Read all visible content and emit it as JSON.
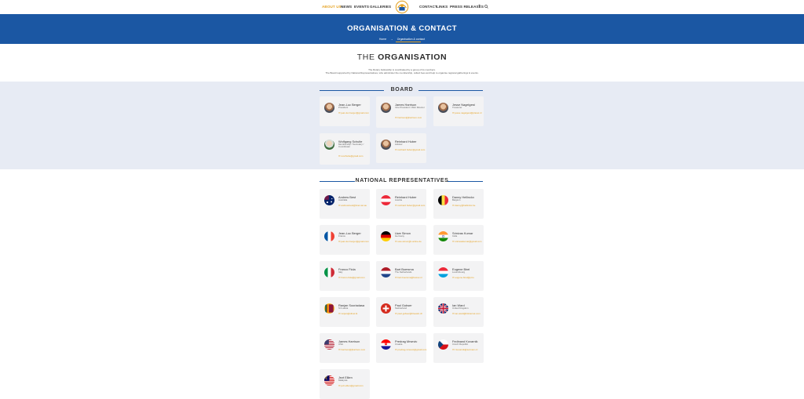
{
  "nav": {
    "left": [
      "ABOUT US",
      "NEWS",
      "EVENTS",
      "GALLERIES"
    ],
    "right": [
      "CONTACT",
      "LINKS",
      "PRESS RELEASES"
    ],
    "active": "ABOUT US",
    "icons": [
      "menu-plus-icon",
      "search-icon"
    ]
  },
  "hero": {
    "title": "ORGANISATION & CONTACT",
    "breadcrumb": [
      "Home",
      "→",
      "Organisation & contact"
    ]
  },
  "org": {
    "title_prefix": "THE",
    "title_bold": "ORGANISATION",
    "intro": [
      "The Rotary Fellowship is coordinated by a group of its members.",
      "The Board supported by National Representatives, who administer the membership, collect fees and help to organise regional gatherings & events."
    ]
  },
  "board": {
    "heading": "BOARD",
    "members": [
      {
        "name": "Jean-Luc Berger",
        "role": "President",
        "email": "jean-luc.berger@gmail.com",
        "avatar": "photo"
      },
      {
        "name": "James Harrison",
        "role": "Vice President / Web Director",
        "email": "harrison@jharrison.com",
        "avatar": "photo"
      },
      {
        "name": "Jesse Nagelgest",
        "role": "Treasurer",
        "email": "jesse.nagelgest@planet.nl",
        "avatar": "photo"
      },
      {
        "name": "Wolfgang Schulte",
        "role": "Membership / Secretary / Coordinator",
        "email": "w.schulte@gmail.com",
        "avatar": "green"
      },
      {
        "name": "Reinhard Huber",
        "role": "Advisor",
        "email": "reinhard.huber@gmail.com",
        "avatar": "photo"
      }
    ]
  },
  "reps": {
    "heading": "NATIONAL REPRESENTATIVES",
    "members": [
      {
        "name": "Andrew Best",
        "country": "Australia",
        "email": "andrew.best@iinet.net.au",
        "flag": "au"
      },
      {
        "name": "Reinhard Huber",
        "country": "Austria",
        "email": "reinhard.huber@gmail.com",
        "flag": "at"
      },
      {
        "name": "Danny Hellinckx",
        "country": "Belgium",
        "email": "danny@hellinckx.be",
        "flag": "be"
      },
      {
        "name": "Jean-Luc Berger",
        "country": "France",
        "email": "jean-luc.berger@gmail.com",
        "flag": "fr"
      },
      {
        "name": "Uwe Simon",
        "country": "Germany",
        "email": "uwe.simon@t-online.de",
        "flag": "de"
      },
      {
        "name": "Srinivas Kumar",
        "country": "India",
        "email": "srinivaskumar@gmail.com",
        "flag": "in"
      },
      {
        "name": "Franco Fiola",
        "country": "Italy",
        "email": "franco.fiola@gmail.com",
        "flag": "it"
      },
      {
        "name": "Bart Boersma",
        "country": "The Netherlands",
        "email": "bart.boersma@hetnet.nl",
        "flag": "nl"
      },
      {
        "name": "Eugene Birel",
        "country": "Luxembourg",
        "email": "eugene.birel@pt.lu",
        "flag": "lu"
      },
      {
        "name": "Ranjan Sooriadasa",
        "country": "Sri Lanka",
        "email": "ranjan@sltnet.lk",
        "flag": "lk"
      },
      {
        "name": "Paul Gubser",
        "country": "Switzerland",
        "email": "paul.gubser@bluewin.ch",
        "flag": "ch"
      },
      {
        "name": "Ian Ward",
        "country": "United Kingdom",
        "email": "ian.ward@btinternet.com",
        "flag": "gb"
      },
      {
        "name": "James Harrison",
        "country": "USA",
        "email": "harrison@jharrison.com",
        "flag": "us"
      },
      {
        "name": "Predrag Mrsevic",
        "country": "Croatia",
        "email": "predrag.mrsevic@gmail.com",
        "flag": "hr"
      },
      {
        "name": "Fedinand Kovarnik",
        "country": "Czech Republic",
        "email": "f.kovarnik@seznam.cz",
        "flag": "cz"
      },
      {
        "name": "Jezt Ellien",
        "country": "Malaysia",
        "email": "jezt.ellien@gmail.com",
        "flag": "my"
      }
    ]
  },
  "colors": {
    "brand_blue": "#1b57a3",
    "accent_gold": "#e5a324",
    "band": "#e7ebf4"
  }
}
